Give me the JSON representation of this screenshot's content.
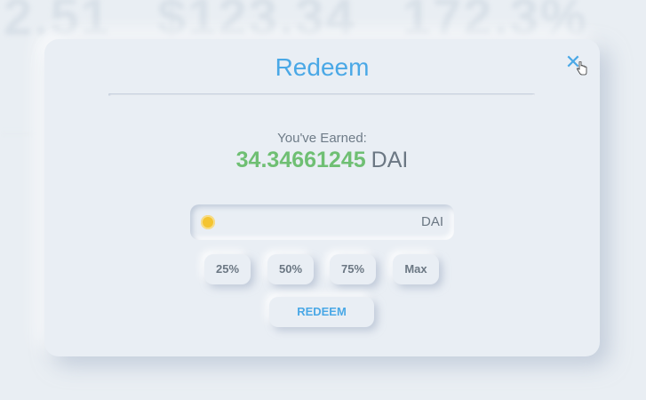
{
  "background": {
    "stats": [
      "2.51",
      "$123.34",
      "172.3%"
    ]
  },
  "modal": {
    "title": "Redeem",
    "close_icon": "close-icon",
    "earned_label": "You've Earned:",
    "earned_amount": "34.34661245",
    "earned_unit": "DAI",
    "input": {
      "value": "",
      "placeholder": "",
      "unit": "DAI",
      "token_icon": "dai-coin-icon"
    },
    "percent_buttons": [
      "25%",
      "50%",
      "75%",
      "Max"
    ],
    "redeem_label": "REDEEM"
  },
  "colors": {
    "accent": "#4aa8e6",
    "earned_green": "#6fbf73",
    "surface": "#e9eef4",
    "coin": "#f4c430"
  }
}
